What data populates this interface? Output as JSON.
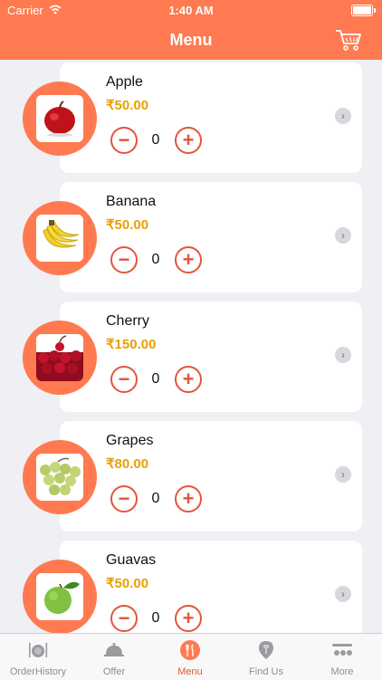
{
  "status": {
    "carrier": "Carrier",
    "time": "1:40 AM"
  },
  "nav": {
    "title": "Menu",
    "cart_icon": "cart-icon"
  },
  "items": [
    {
      "name": "Apple",
      "price": "₹50.00",
      "qty": "0",
      "minus": "−",
      "plus": "+",
      "chevron": "›"
    },
    {
      "name": "Banana",
      "price": "₹50.00",
      "qty": "0",
      "minus": "−",
      "plus": "+",
      "chevron": "›"
    },
    {
      "name": "Cherry",
      "price": "₹150.00",
      "qty": "0",
      "minus": "−",
      "plus": "+",
      "chevron": "›"
    },
    {
      "name": "Grapes",
      "price": "₹80.00",
      "qty": "0",
      "minus": "−",
      "plus": "+",
      "chevron": "›"
    },
    {
      "name": "Guavas",
      "price": "₹50.00",
      "qty": "0",
      "minus": "−",
      "plus": "+",
      "chevron": "›"
    }
  ],
  "tabs": [
    {
      "label": "OrderHistory",
      "icon": "plate-cutlery-icon"
    },
    {
      "label": "Offer",
      "icon": "covered-dish-icon"
    },
    {
      "label": "Menu",
      "icon": "menu-cutlery-icon",
      "active": true
    },
    {
      "label": "Find Us",
      "icon": "location-pin-icon"
    },
    {
      "label": "More",
      "icon": "more-icon"
    }
  ],
  "colors": {
    "accent": "#ff7a50",
    "price": "#e8a000",
    "button": "#e3553b",
    "background": "#efeff4"
  }
}
